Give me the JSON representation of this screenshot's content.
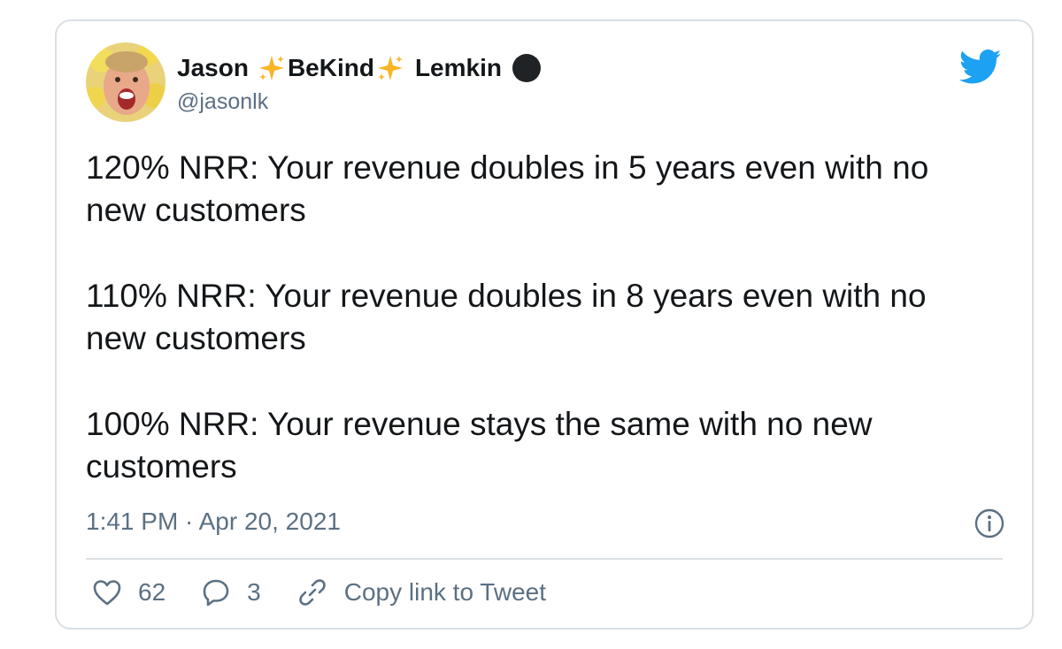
{
  "tweet": {
    "author": {
      "name_first": "Jason",
      "name_middle": "BeKind",
      "name_last": "Lemkin",
      "handle": "@jasonlk"
    },
    "paragraphs": [
      "120% NRR:  Your revenue doubles in 5 years even with no new customers",
      "110% NRR:  Your revenue doubles in 8 years even with no new customers",
      "100% NRR:  Your revenue stays the same with no new customers"
    ],
    "timestamp": "1:41 PM · Apr 20, 2021",
    "likes": "62",
    "replies": "3",
    "copy_link_label": "Copy link to Tweet"
  },
  "colors": {
    "brand": "#1da1f2",
    "text": "#14171a",
    "secondary": "#5b7083",
    "border": "#dadfe3"
  },
  "icons": [
    "twitter-bird-icon",
    "sparkle-icon",
    "info-icon",
    "heart-icon",
    "reply-icon",
    "link-icon"
  ]
}
